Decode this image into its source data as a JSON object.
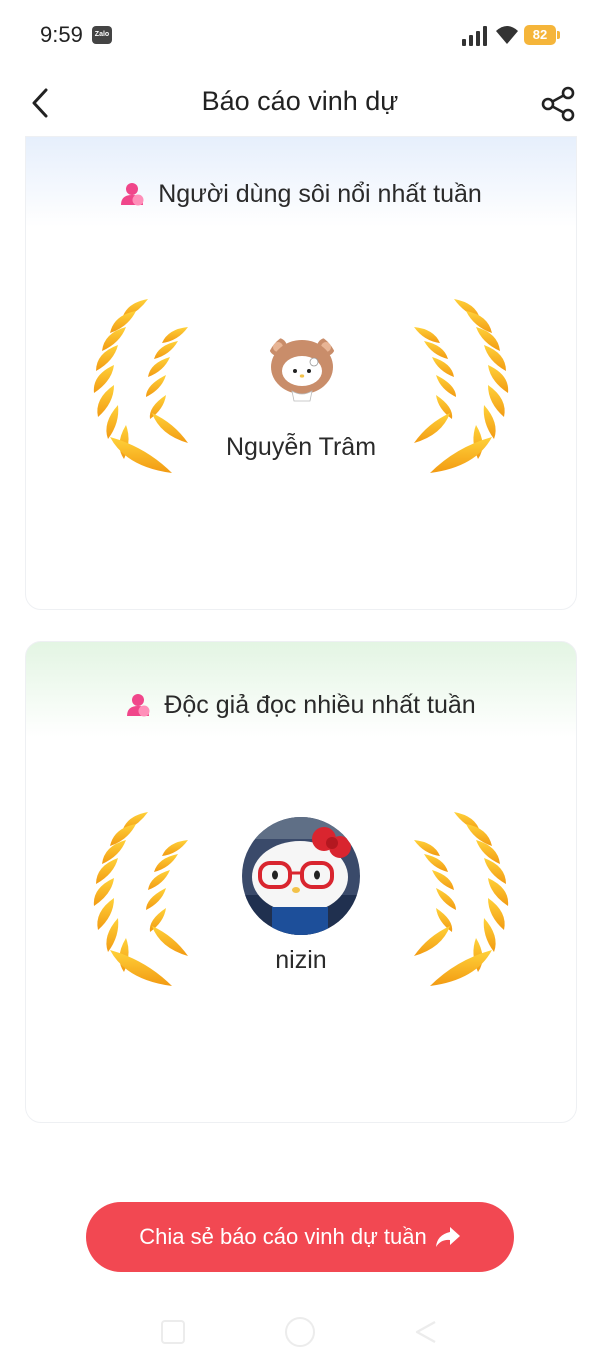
{
  "status_bar": {
    "time": "9:59",
    "app_badge": "Zalo",
    "battery": "82"
  },
  "header": {
    "title": "Báo cáo vinh dự"
  },
  "cards": [
    {
      "heading": "Người dùng sôi nổi nhất tuần",
      "name": "Nguyễn Trâm",
      "accent": "#e6effc"
    },
    {
      "heading": "Độc giả đọc nhiều nhất tuần",
      "name": "nizin",
      "accent": "#e3f5e3"
    }
  ],
  "share_button": {
    "label": "Chia sẻ báo cáo vinh dự tuần"
  },
  "colors": {
    "primary_button": "#f24852",
    "icon_pink": "#f0468a",
    "laurel_light": "#ffd23a",
    "laurel_dark": "#f29a12"
  }
}
